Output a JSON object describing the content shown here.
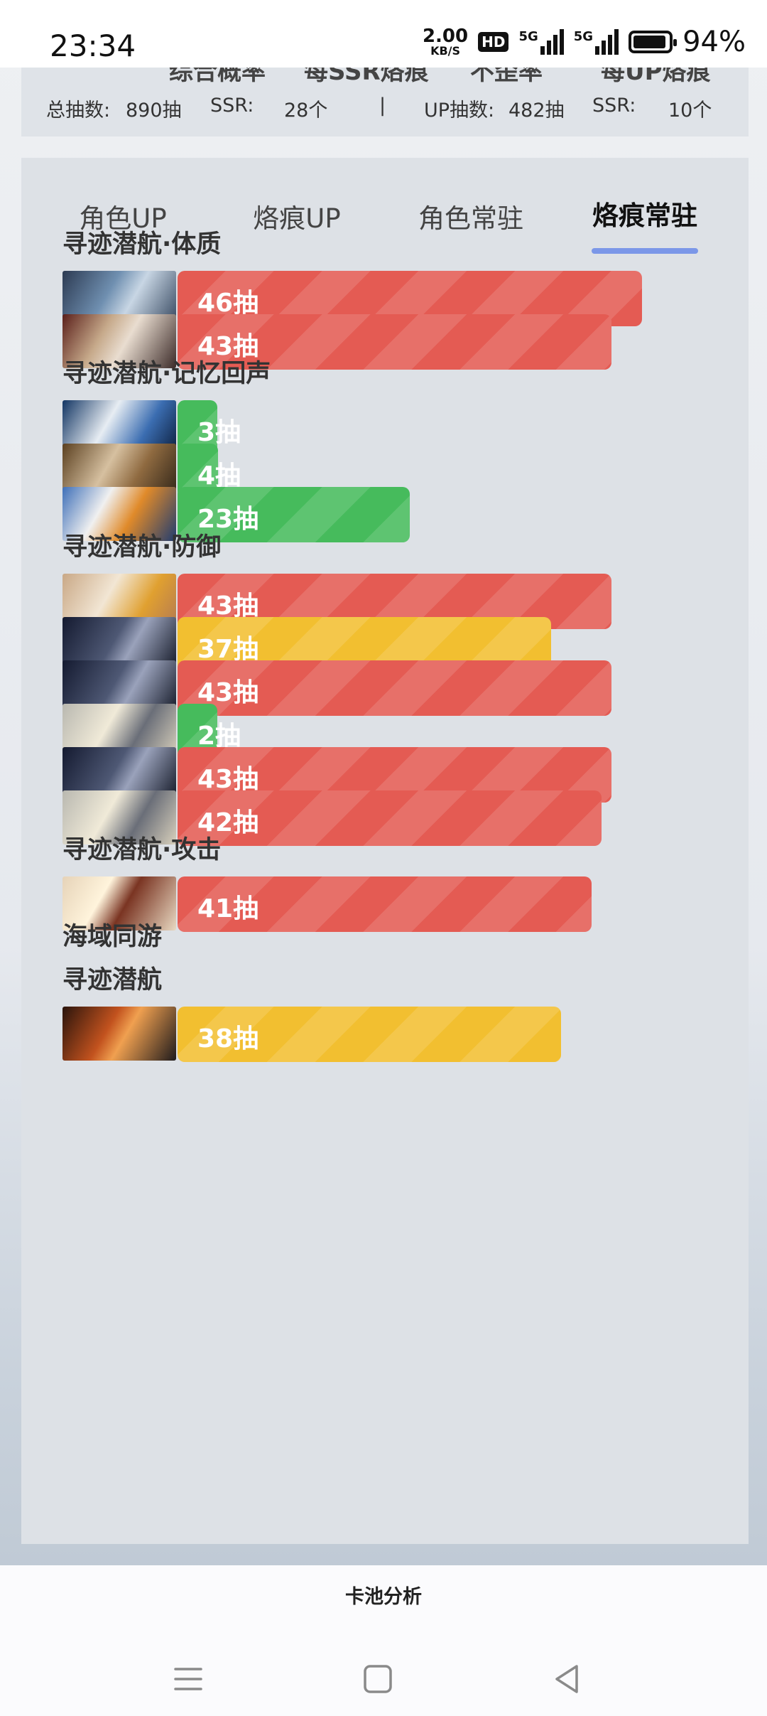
{
  "status_bar": {
    "time": "23:34",
    "net_speed_value": "2.00",
    "net_speed_unit": "KB/S",
    "hd_label": "HD",
    "signal1_label": "5G",
    "signal2_label": "5G",
    "battery_percent": "94%",
    "battery_level": 0.94
  },
  "summary": {
    "cut_headers": [
      "综合概率",
      "每SSR烙痕",
      "不歪率",
      "每UP烙痕"
    ],
    "total_pulls_label": "总抽数:",
    "total_pulls_value": "890抽",
    "ssr_label_1": "SSR:",
    "ssr_value_1": "28个",
    "separator": "|",
    "up_pulls_label": "UP抽数:",
    "up_pulls_value": "482抽",
    "ssr_label_2": "SSR:",
    "ssr_value_2": "10个"
  },
  "tabs": [
    {
      "label": "角色UP",
      "active": false
    },
    {
      "label": "烙痕UP",
      "active": false
    },
    {
      "label": "角色常驻",
      "active": false
    },
    {
      "label": "烙痕常驻",
      "active": true
    }
  ],
  "sections": [
    {
      "title": "寻迹潜航·体质",
      "rows": [
        {
          "label": "46抽",
          "pulls": 46,
          "color": "#e45b53",
          "thumb": "character-art-1"
        },
        {
          "label": "43抽",
          "pulls": 43,
          "color": "#e45b53",
          "thumb": "character-art-2"
        }
      ]
    },
    {
      "title": "寻迹潜航·记忆回声",
      "rows": [
        {
          "label": "3抽",
          "pulls": 3,
          "color": "#46bb5c",
          "thumb": "character-art-3"
        },
        {
          "label": "4抽",
          "pulls": 4,
          "color": "#46bb5c",
          "thumb": "character-art-4"
        },
        {
          "label": "23抽",
          "pulls": 23,
          "color": "#46bb5c",
          "thumb": "character-art-5"
        }
      ]
    },
    {
      "title": "寻迹潜航·防御",
      "rows": [
        {
          "label": "43抽",
          "pulls": 43,
          "color": "#e45b53",
          "thumb": "character-art-6"
        },
        {
          "label": "37抽",
          "pulls": 37,
          "color": "#f2bf30",
          "thumb": "character-art-7"
        },
        {
          "label": "43抽",
          "pulls": 43,
          "color": "#e45b53",
          "thumb": "character-art-7"
        },
        {
          "label": "2抽",
          "pulls": 2,
          "color": "#46bb5c",
          "thumb": "character-art-8"
        },
        {
          "label": "43抽",
          "pulls": 43,
          "color": "#e45b53",
          "thumb": "character-art-7"
        },
        {
          "label": "42抽",
          "pulls": 42,
          "color": "#e45b53",
          "thumb": "character-art-8"
        }
      ]
    },
    {
      "title": "寻迹潜航·攻击",
      "rows": [
        {
          "label": "41抽",
          "pulls": 41,
          "color": "#e45b53",
          "thumb": "character-art-9"
        }
      ]
    },
    {
      "title": "海域同游",
      "rows": []
    },
    {
      "title": "寻迹潜航",
      "rows": [
        {
          "label": "38抽",
          "pulls": 38,
          "color": "#f2bf30",
          "thumb": "character-art-10"
        }
      ]
    }
  ],
  "bottom": {
    "title": "卡池分析"
  },
  "nav_icons": [
    "menu-icon",
    "home-icon",
    "back-icon"
  ]
}
